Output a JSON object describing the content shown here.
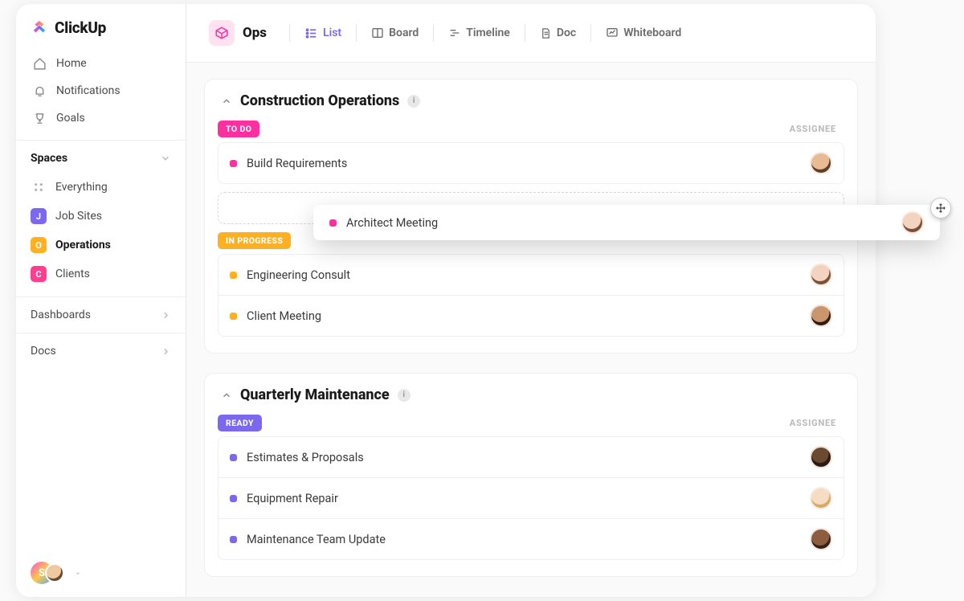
{
  "brand": {
    "name": "ClickUp"
  },
  "sidebar": {
    "nav": [
      {
        "icon": "home",
        "label": "Home"
      },
      {
        "icon": "bell",
        "label": "Notifications"
      },
      {
        "icon": "trophy",
        "label": "Goals"
      }
    ],
    "spaces_header": "Spaces",
    "everything_label": "Everything",
    "spaces": [
      {
        "letter": "J",
        "label": "Job Sites",
        "color": "#7b68ee",
        "active": false
      },
      {
        "letter": "O",
        "label": "Operations",
        "color": "#ffb020",
        "active": true
      },
      {
        "letter": "C",
        "label": "Clients",
        "color": "#ff3e8f",
        "active": false
      }
    ],
    "dashboards_label": "Dashboards",
    "docs_label": "Docs",
    "footer_avatar_letter": "S"
  },
  "topbar": {
    "space_name": "Ops",
    "views": [
      {
        "icon": "list",
        "label": "List",
        "active": true
      },
      {
        "icon": "board",
        "label": "Board"
      },
      {
        "icon": "timeline",
        "label": "Timeline"
      },
      {
        "icon": "doc",
        "label": "Doc"
      },
      {
        "icon": "whiteboard",
        "label": "Whiteboard"
      }
    ]
  },
  "columns": {
    "assignee": "ASSIGNEE"
  },
  "groups": [
    {
      "title": "Construction Operations",
      "sections": [
        {
          "status": "TO DO",
          "status_color": "#ff2fa0",
          "bullet_color": "#ff2fa0",
          "tasks": [
            {
              "name": "Build Requirements",
              "avatar": "a1"
            }
          ],
          "has_dropzone": true
        },
        {
          "status": "IN PROGRESS",
          "status_color": "#ffb020",
          "bullet_color": "#ffb020",
          "tasks": [
            {
              "name": "Engineering Consult",
              "avatar": "a2"
            },
            {
              "name": "Client Meeting",
              "avatar": "a3"
            }
          ]
        }
      ]
    },
    {
      "title": "Quarterly Maintenance",
      "sections": [
        {
          "status": "READY",
          "status_color": "#7b68ee",
          "bullet_color": "#7b68ee",
          "tasks": [
            {
              "name": "Estimates & Proposals",
              "avatar": "a4"
            },
            {
              "name": "Equipment Repair",
              "avatar": "a5"
            },
            {
              "name": "Maintenance Team Update",
              "avatar": "a6"
            }
          ]
        }
      ]
    }
  ],
  "drag": {
    "task_name": "Architect Meeting",
    "bullet_color": "#ff2fa0",
    "avatar": "a2"
  }
}
